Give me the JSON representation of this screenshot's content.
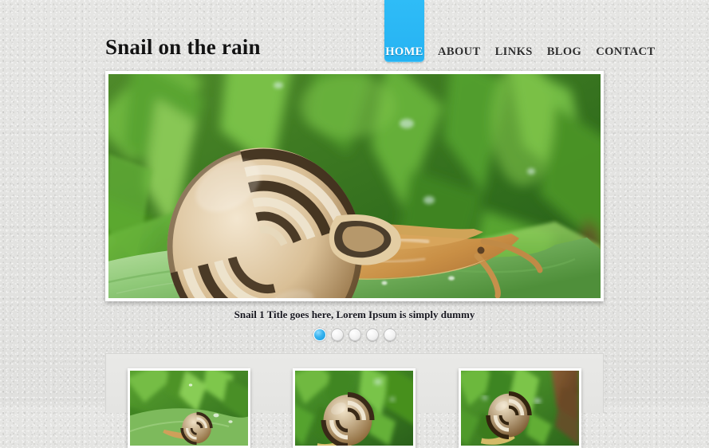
{
  "site": {
    "title": "Snail on the rain"
  },
  "nav": {
    "items": [
      {
        "label": "HOME",
        "active": true
      },
      {
        "label": "ABOUT",
        "active": false
      },
      {
        "label": "LINKS",
        "active": false
      },
      {
        "label": "BLOG",
        "active": false
      },
      {
        "label": "CONTACT",
        "active": false
      }
    ]
  },
  "slider": {
    "caption": "Snail 1 Title goes here, Lorem Ipsum is simply dummy",
    "main_image_alt": "Banded grove snail with striped shell crawling on a wet green leaf",
    "pager": {
      "total": 5,
      "active_index": 1
    }
  },
  "thumbnails": [
    {
      "alt": "Snail on green leaves thumbnail"
    },
    {
      "alt": "Close-up of striped snail shell thumbnail"
    },
    {
      "alt": "Snail on grass blades with brown stem thumbnail"
    }
  ],
  "colors": {
    "accent": "#29b6f6",
    "page_background": "#e3e3e1",
    "panel_background": "#e7e7e5",
    "text": "#1b1b1b"
  }
}
